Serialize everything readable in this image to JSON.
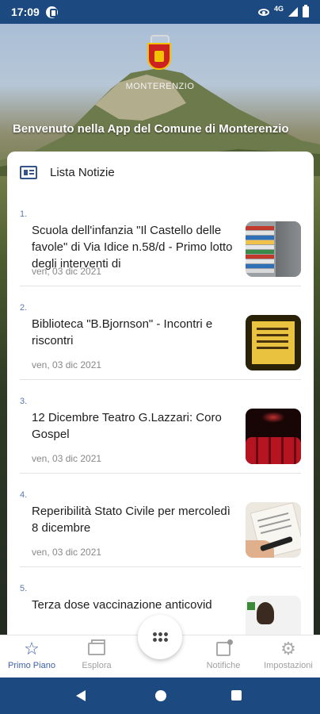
{
  "status_bar": {
    "time": "17:09",
    "network": "4G",
    "icons": [
      "app-notification-icon",
      "eye-icon",
      "signal-icon",
      "battery-icon"
    ]
  },
  "header": {
    "municipality_logo_label": "MONTERENZIO",
    "welcome": "Benvenuto nella App del Comune di Monterenzio"
  },
  "news": {
    "title": "Lista Notizie",
    "items": [
      {
        "num": "1.",
        "title": "Scuola dell'infanzia \"Il Castello delle favole\" di Via Idice n.58/d - Primo lotto degli interventi di",
        "date": "ven, 03 dic 2021",
        "thumb": "books"
      },
      {
        "num": "2.",
        "title": "Biblioteca \"B.Bjornson\" - Incontri e riscontri",
        "date": "ven, 03 dic 2021",
        "thumb": "library-poster"
      },
      {
        "num": "3.",
        "title": "12 Dicembre Teatro G.Lazzari: Coro Gospel",
        "date": "ven, 03 dic 2021",
        "thumb": "theatre-seats"
      },
      {
        "num": "4.",
        "title": "Reperibilità Stato Civile per mercoledì 8 dicembre",
        "date": "ven, 03 dic 2021",
        "thumb": "document-signing"
      },
      {
        "num": "5.",
        "title": "Terza dose vaccinazione anticovid",
        "date": "",
        "thumb": "vaccination"
      }
    ]
  },
  "bottom_nav": {
    "items": [
      {
        "label": "Primo Piano",
        "icon": "star-icon",
        "active": true
      },
      {
        "label": "Esplora",
        "icon": "explore-icon",
        "active": false
      },
      {
        "label": "Notifiche",
        "icon": "notification-icon",
        "active": false
      },
      {
        "label": "Impostazioni",
        "icon": "gear-icon",
        "active": false
      }
    ],
    "center_icon": "grid-menu-icon"
  },
  "colors": {
    "status_bar": "#1c4a80",
    "accent": "#3f5fa8",
    "number": "#5b79b6"
  }
}
